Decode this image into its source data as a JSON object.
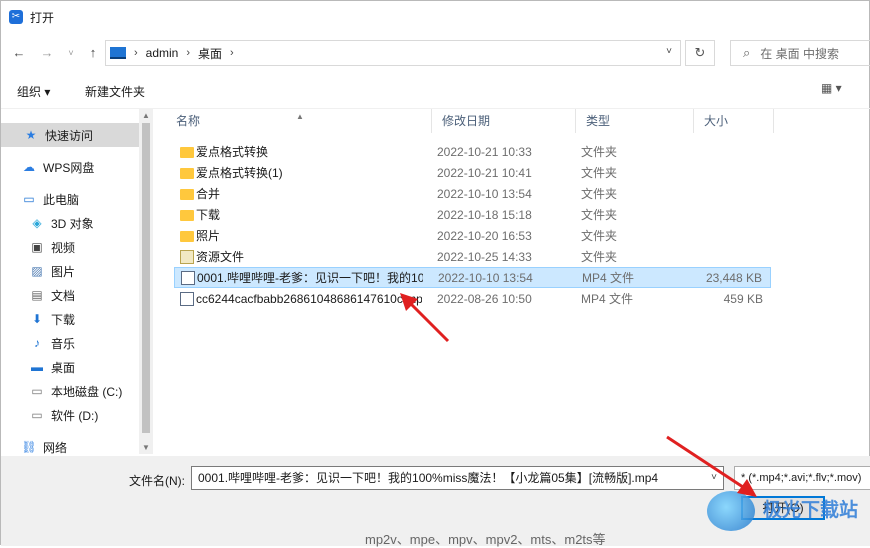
{
  "window": {
    "title": "打开",
    "app_icon": "app-icon"
  },
  "nav": {
    "back_icon": "arrow-left-icon",
    "forward_icon": "arrow-right-icon",
    "recent_icon": "chevron-down-icon",
    "up_icon": "arrow-up-icon",
    "breadcrumb": [
      "admin",
      "桌面"
    ],
    "refresh_icon": "refresh-icon",
    "search_placeholder": "在 桌面 中搜索"
  },
  "toolbar": {
    "organize": "组织 ▾",
    "new_folder": "新建文件夹",
    "view": "▦ ▾"
  },
  "sidebar": {
    "items": [
      {
        "label": "快速访问",
        "icon": "star-icon",
        "glyph": "★",
        "color": "#2b7de1"
      },
      {
        "label": "WPS网盘",
        "icon": "cloud-icon",
        "glyph": "☁",
        "color": "#2b7de1"
      },
      {
        "label": "此电脑",
        "icon": "computer-icon",
        "glyph": "▭",
        "color": "#1f74d3"
      },
      {
        "label": "3D 对象",
        "icon": "cube-icon",
        "glyph": "◈",
        "color": "#2aa7d9"
      },
      {
        "label": "视频",
        "icon": "film-icon",
        "glyph": "▣",
        "color": "#444"
      },
      {
        "label": "图片",
        "icon": "picture-icon",
        "glyph": "▨",
        "color": "#4a78b0"
      },
      {
        "label": "文档",
        "icon": "document-icon",
        "glyph": "▤",
        "color": "#666"
      },
      {
        "label": "下载",
        "icon": "download-icon",
        "glyph": "⬇",
        "color": "#1f74d3"
      },
      {
        "label": "音乐",
        "icon": "music-icon",
        "glyph": "♪",
        "color": "#1f74d3"
      },
      {
        "label": "桌面",
        "icon": "desktop-icon",
        "glyph": "▬",
        "color": "#1f74d3"
      },
      {
        "label": "本地磁盘 (C:)",
        "icon": "drive-icon",
        "glyph": "▭",
        "color": "#777"
      },
      {
        "label": "软件 (D:)",
        "icon": "drive-icon",
        "glyph": "▭",
        "color": "#777"
      },
      {
        "label": "网络",
        "icon": "network-icon",
        "glyph": "⛓",
        "color": "#2b7de1"
      }
    ]
  },
  "columns": {
    "name": "名称",
    "date": "修改日期",
    "type": "类型",
    "size": "大小"
  },
  "files": [
    {
      "name": "爱点格式转换",
      "date": "2022-10-21 10:33",
      "type": "文件夹",
      "size": "",
      "kind": "folder"
    },
    {
      "name": "爱点格式转换(1)",
      "date": "2022-10-21 10:41",
      "type": "文件夹",
      "size": "",
      "kind": "folder"
    },
    {
      "name": "合并",
      "date": "2022-10-10 13:54",
      "type": "文件夹",
      "size": "",
      "kind": "folder"
    },
    {
      "name": "下载",
      "date": "2022-10-18 15:18",
      "type": "文件夹",
      "size": "",
      "kind": "folder"
    },
    {
      "name": "照片",
      "date": "2022-10-20 16:53",
      "type": "文件夹",
      "size": "",
      "kind": "folder"
    },
    {
      "name": "资源文件",
      "date": "2022-10-25 14:33",
      "type": "文件夹",
      "size": "",
      "kind": "zip"
    },
    {
      "name": "0001.哔哩哔哩-老爹：见识一下吧！我的100%miss魔法！【小龙篇05集】[流畅版].mp4",
      "date": "2022-10-10 13:54",
      "type": "MP4 文件",
      "size": "23,448 KB",
      "kind": "video",
      "selected": true
    },
    {
      "name": "cc6244cacfbabb26861048686147610c.mp4",
      "date": "2022-08-26 10:50",
      "type": "MP4 文件",
      "size": "459 KB",
      "kind": "video"
    }
  ],
  "bottom": {
    "filename_label": "文件名(N):",
    "filename_value": "0001.哔哩哔哩-老爹：见识一下吧！我的100%miss魔法！【小龙篇05集】[流畅版].mp4",
    "filter_value": "* (*.mp4;*.avi;*.flv;*.mov)",
    "open_label": "打开(O)",
    "watermark": "极光下载站",
    "under_text": "mp2v、mpe、mpv、mpv2、mts、m2ts等"
  },
  "colors": {
    "accent": "#0078d7",
    "selection": "#cce8ff",
    "arrow": "#e02020"
  }
}
